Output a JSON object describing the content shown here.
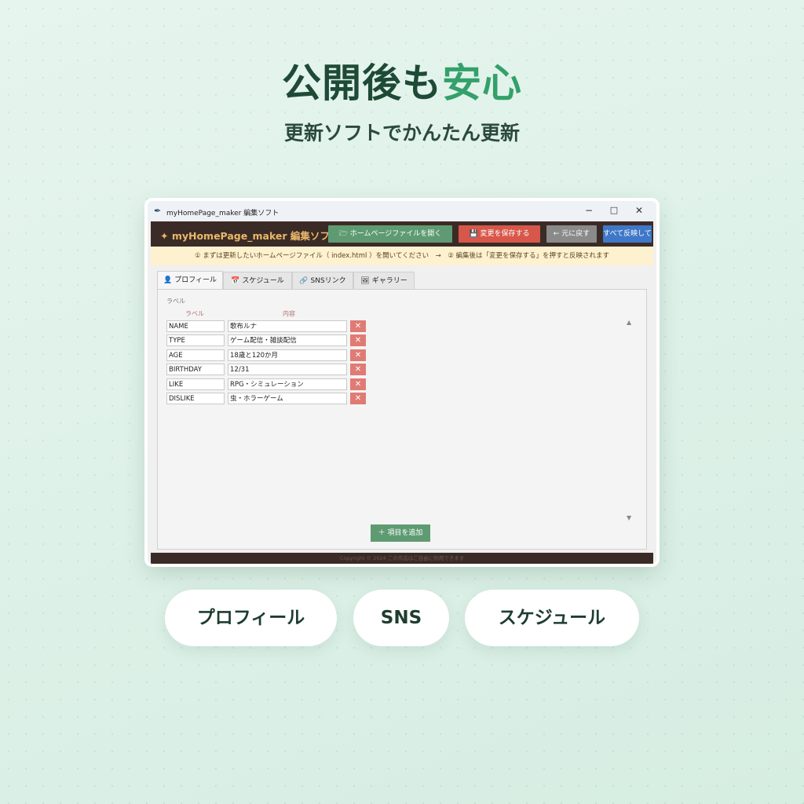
{
  "hero": {
    "title_main": "公開後も",
    "title_accent": "安心",
    "subtitle": "更新ソフトでかんたん更新"
  },
  "window": {
    "title": "myHomePage_maker 編集ソフト",
    "controls": {
      "minimize": "−",
      "maximize": "□",
      "close": "✕"
    }
  },
  "toolbar": {
    "brand": "✦ myHomePage_maker 編集ソフト",
    "open_file": "ホームページファイルを開く",
    "save": "変更を保存する",
    "undo": "← 元に戻す",
    "apply_all": "すべて反映して"
  },
  "notice": "① まずは更新したいホームページファイル（ index.html ）を開いてください　→　② 編集後は「変更を保存する」を押すと反映されます",
  "tabs": [
    {
      "icon": "person-icon",
      "glyph": "👤",
      "label": "プロフィール"
    },
    {
      "icon": "calendar-icon",
      "glyph": "📅",
      "label": "スケジュール"
    },
    {
      "icon": "link-icon",
      "glyph": "🔗",
      "label": "SNSリンク"
    },
    {
      "icon": "image-icon",
      "glyph": "🖼",
      "label": "ギャラリー"
    }
  ],
  "profile": {
    "section_label": "ラベル",
    "col_label": "ラベル",
    "col_content": "内容",
    "rows": [
      {
        "label": "NAME",
        "content": "歌布ルナ"
      },
      {
        "label": "TYPE",
        "content": "ゲーム配信・雑談配信"
      },
      {
        "label": "AGE",
        "content": "18歳と120か月"
      },
      {
        "label": "BIRTHDAY",
        "content": "12/31"
      },
      {
        "label": "LIKE",
        "content": "RPG・シミュレーション"
      },
      {
        "label": "DISLIKE",
        "content": "虫・ホラーゲーム"
      }
    ],
    "delete_glyph": "✕",
    "add_button": "＋ 項目を追加"
  },
  "footer": "Copyright © 2024 この作品はご自由に利用できます",
  "chips": [
    "プロフィール",
    "SNS",
    "スケジュール"
  ],
  "colors": {
    "accent": "#34a06a",
    "appbar": "#3b2b26",
    "btn_open": "#5f9b72",
    "btn_save": "#d7574a",
    "btn_undo": "#8a8a8a",
    "btn_apply": "#3f78c8"
  }
}
